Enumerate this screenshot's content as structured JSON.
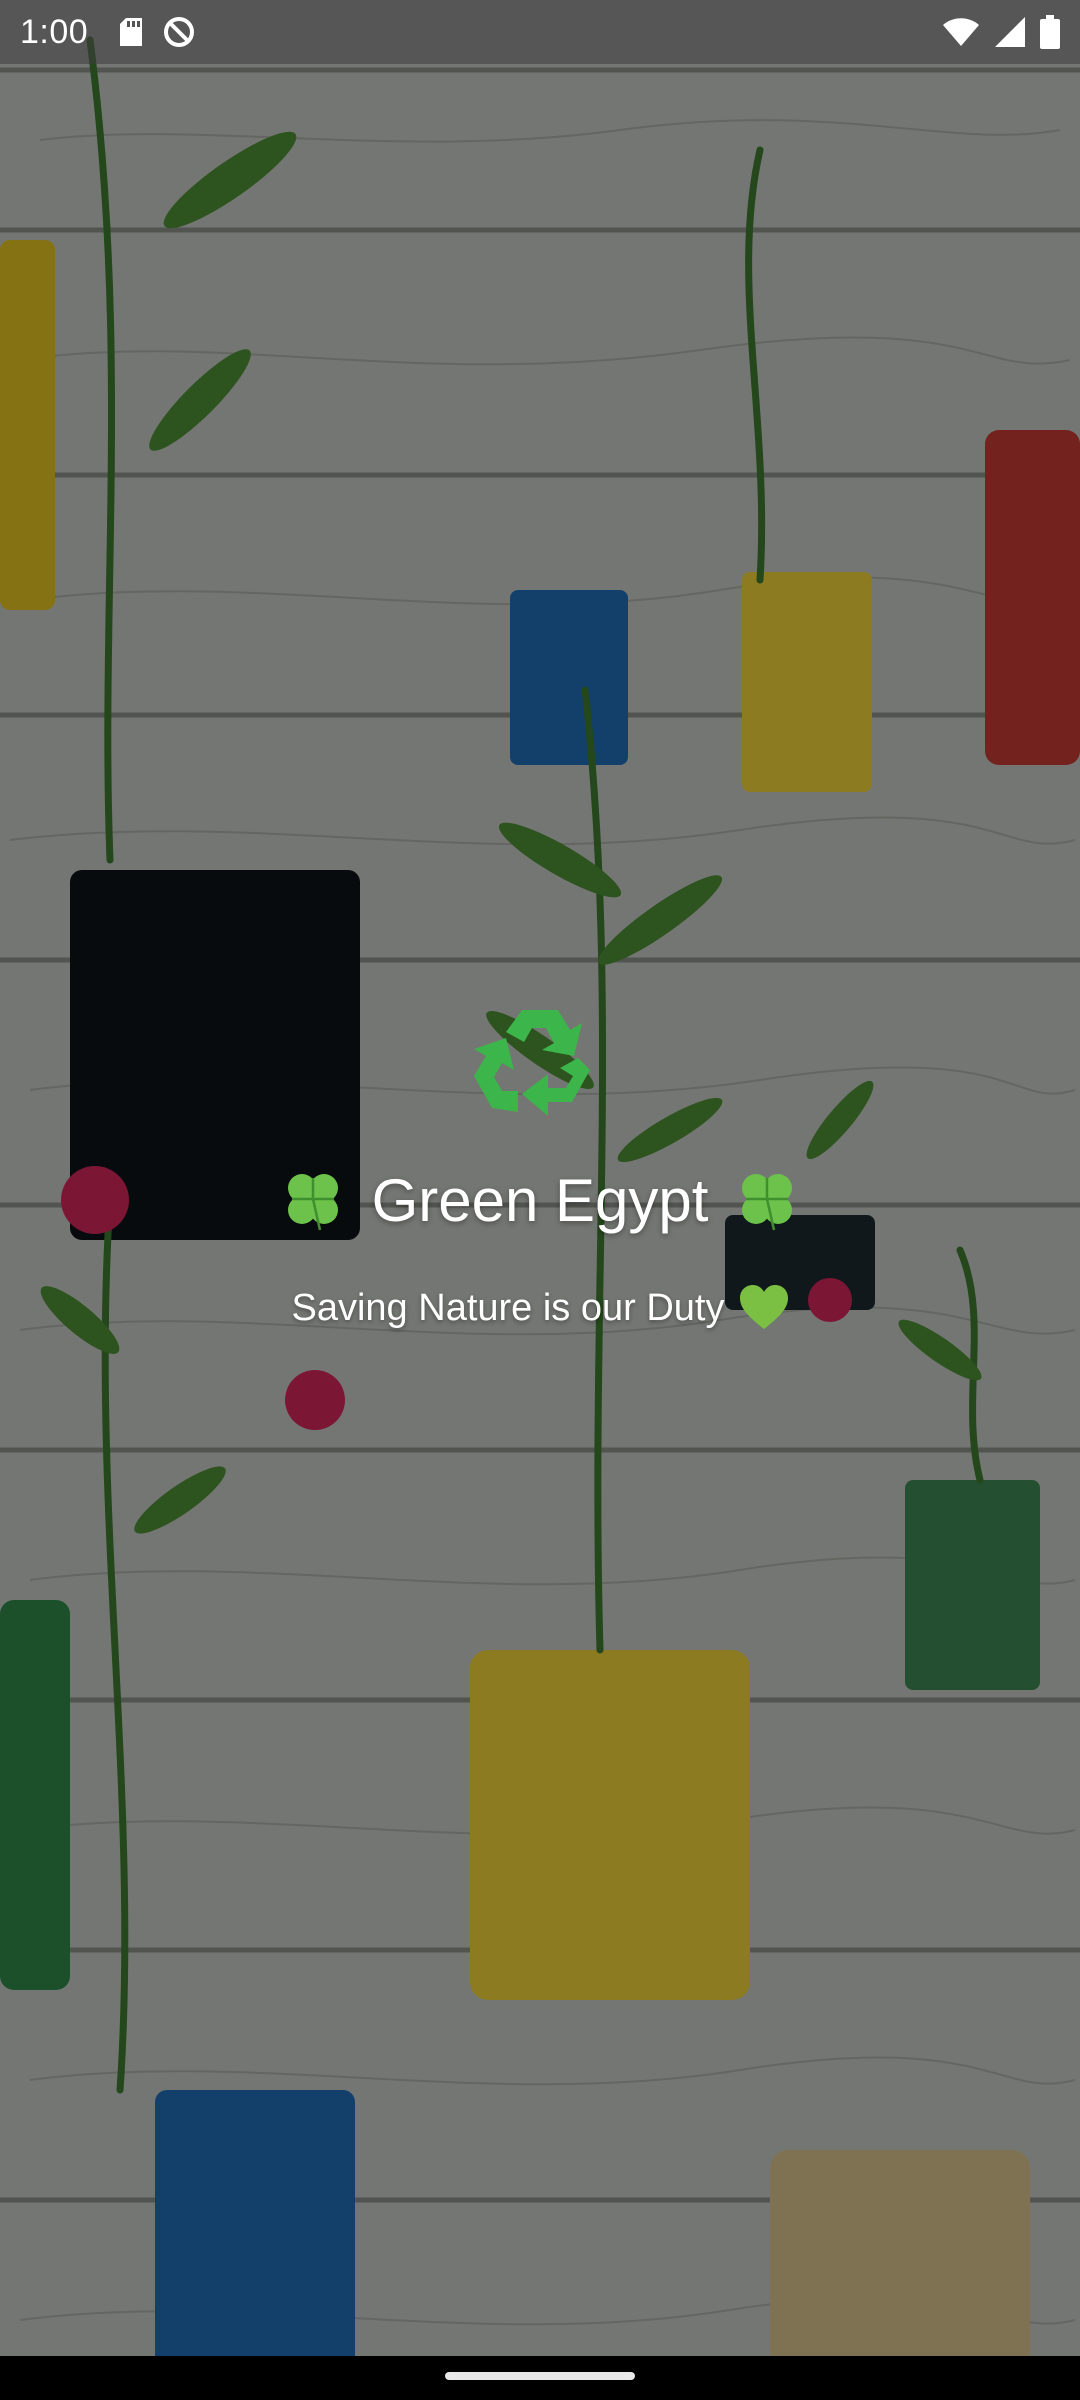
{
  "status_bar": {
    "time": "1:00",
    "left_icons": [
      "sd-card-icon",
      "do-not-disturb-icon"
    ],
    "right_icons": [
      "wifi-icon",
      "cellular-signal-icon",
      "battery-icon"
    ]
  },
  "splash": {
    "logo_icon": "recycle-icon",
    "title": "Green Egypt",
    "title_left_icon": "four-leaf-clover-icon",
    "title_right_icon": "four-leaf-clover-icon",
    "subtitle": "Saving Nature is our Duty",
    "subtitle_icon": "green-heart-icon"
  },
  "colors": {
    "recycle_green": "#3cb54a",
    "clover_green": "#6cc24a",
    "heart_green": "#7bc043",
    "text": "#ffffff",
    "overlay": "#000000"
  }
}
